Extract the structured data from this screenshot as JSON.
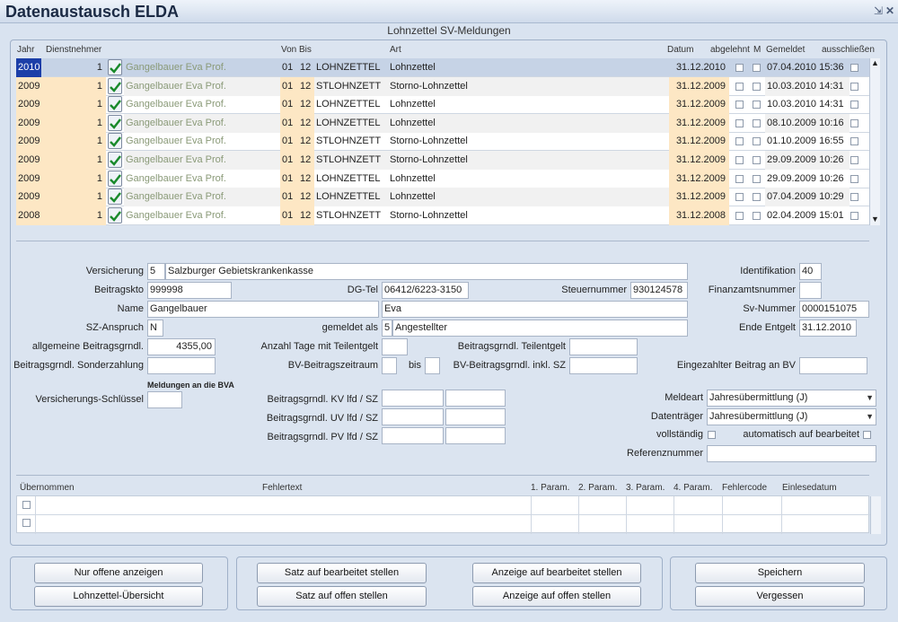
{
  "window": {
    "title": "Datenaustausch ELDA",
    "pin_icon": "pin-icon",
    "close_icon": "close-icon"
  },
  "subtitle": "Lohnzettel SV-Meldungen",
  "table": {
    "headers": {
      "jahr": "Jahr",
      "dn": "Dienstnehmer",
      "von": "Von",
      "bis": "Bis",
      "art": "Art",
      "datum": "Datum",
      "abgelehnt": "abgelehnt",
      "m": "M",
      "gemeldet": "Gemeldet",
      "ausschliessen": "ausschließen"
    },
    "rows": [
      {
        "jahr": "2010",
        "nr": "1",
        "name": "Gangelbauer Eva Prof.",
        "von": "01",
        "bis": "12",
        "code": "LOHNZETTEL",
        "art": "Lohnzettel",
        "datum": "31.12.2010",
        "gemeldet": "07.04.2010 15:36"
      },
      {
        "jahr": "2009",
        "nr": "1",
        "name": "Gangelbauer Eva Prof.",
        "von": "01",
        "bis": "12",
        "code": "STLOHNZETT",
        "art": "Storno-Lohnzettel",
        "datum": "31.12.2009",
        "gemeldet": "10.03.2010 14:31"
      },
      {
        "jahr": "2009",
        "nr": "1",
        "name": "Gangelbauer Eva Prof.",
        "von": "01",
        "bis": "12",
        "code": "LOHNZETTEL",
        "art": "Lohnzettel",
        "datum": "31.12.2009",
        "gemeldet": "10.03.2010 14:31"
      },
      {
        "jahr": "2009",
        "nr": "1",
        "name": "Gangelbauer Eva Prof.",
        "von": "01",
        "bis": "12",
        "code": "LOHNZETTEL",
        "art": "Lohnzettel",
        "datum": "31.12.2009",
        "gemeldet": "08.10.2009 10:16"
      },
      {
        "jahr": "2009",
        "nr": "1",
        "name": "Gangelbauer Eva Prof.",
        "von": "01",
        "bis": "12",
        "code": "STLOHNZETT",
        "art": "Storno-Lohnzettel",
        "datum": "31.12.2009",
        "gemeldet": "01.10.2009 16:55"
      },
      {
        "jahr": "2009",
        "nr": "1",
        "name": "Gangelbauer Eva Prof.",
        "von": "01",
        "bis": "12",
        "code": "STLOHNZETT",
        "art": "Storno-Lohnzettel",
        "datum": "31.12.2009",
        "gemeldet": "29.09.2009 10:26"
      },
      {
        "jahr": "2009",
        "nr": "1",
        "name": "Gangelbauer Eva Prof.",
        "von": "01",
        "bis": "12",
        "code": "LOHNZETTEL",
        "art": "Lohnzettel",
        "datum": "31.12.2009",
        "gemeldet": "29.09.2009 10:26"
      },
      {
        "jahr": "2009",
        "nr": "1",
        "name": "Gangelbauer Eva Prof.",
        "von": "01",
        "bis": "12",
        "code": "LOHNZETTEL",
        "art": "Lohnzettel",
        "datum": "31.12.2009",
        "gemeldet": "07.04.2009 10:29"
      },
      {
        "jahr": "2008",
        "nr": "1",
        "name": "Gangelbauer Eva Prof.",
        "von": "01",
        "bis": "12",
        "code": "STLOHNZETT",
        "art": "Storno-Lohnzettel",
        "datum": "31.12.2008",
        "gemeldet": "02.04.2009 15:01"
      }
    ]
  },
  "form": {
    "versicherung": {
      "label": "Versicherung",
      "nr": "5",
      "value": "Salzburger Gebietskrankenkasse"
    },
    "identifikation": {
      "label": "Identifikation",
      "value": "40"
    },
    "beitragskto": {
      "label": "Beitragskto",
      "value": "999998"
    },
    "dgtel": {
      "label": "DG-Tel",
      "value": "06412/6223-3150"
    },
    "steuernummer": {
      "label": "Steuernummer",
      "value": "930124578"
    },
    "finanzamt": {
      "label": "Finanzamtsnummer",
      "value": ""
    },
    "name": {
      "label": "Name",
      "value": "Gangelbauer",
      "vorname": "Eva"
    },
    "svnummer": {
      "label": "Sv-Nummer",
      "value": "0000151075"
    },
    "szanspruch": {
      "label": "SZ-Anspruch",
      "value": "N"
    },
    "gemeldet_als": {
      "label": "gemeldet als",
      "nr": "5",
      "value": "Angestellter"
    },
    "ende_entgelt": {
      "label": "Ende Entgelt",
      "value": "31.12.2010"
    },
    "allg_bgl": {
      "label": "allgemeine Beitragsgrndl.",
      "value": "4355,00"
    },
    "tage_teilentgelt": {
      "label": "Anzahl Tage mit Teilentgelt",
      "value": ""
    },
    "bgl_teilentgelt": {
      "label": "Beitragsgrndl. Teilentgelt",
      "value": ""
    },
    "bgl_sonderzahlung": {
      "label": "Beitragsgrndl. Sonderzahlung",
      "value": ""
    },
    "bv_zeitraum": {
      "label": "BV-Beitragszeitraum",
      "bis": "bis"
    },
    "bv_bgl_sz": {
      "label": "BV-Beitragsgrndl. inkl. SZ",
      "value": ""
    },
    "bv_eingezahlt": {
      "label": "Eingezahlter Beitrag an BV",
      "value": ""
    },
    "bva_heading": "Meldungen an die BVA",
    "vers_schluessel": {
      "label": "Versicherungs-Schlüssel",
      "value": ""
    },
    "kv": {
      "label": "Beitragsgrndl. KV lfd / SZ"
    },
    "uv": {
      "label": "Beitragsgrndl. UV lfd / SZ"
    },
    "pv": {
      "label": "Beitragsgrndl. PV lfd / SZ"
    },
    "meldeart": {
      "label": "Meldeart",
      "value": "Jahresübermittlung (J)"
    },
    "datentraeger": {
      "label": "Datenträger",
      "value": "Jahresübermittlung (J)"
    },
    "vollstaendig": {
      "label": "vollständig"
    },
    "auto_bearbeitet": {
      "label": "automatisch auf bearbeitet"
    },
    "referenznummer": {
      "label": "Referenznummer",
      "value": ""
    }
  },
  "errors": {
    "headers": {
      "uebernommen": "Übernommen",
      "fehlertext": "Fehlertext",
      "p1": "1. Param.",
      "p2": "2. Param.",
      "p3": "3. Param.",
      "p4": "4. Param.",
      "code": "Fehlercode",
      "datum": "Einlesedatum"
    }
  },
  "buttons": {
    "nur_offene": "Nur offene anzeigen",
    "lohnzettel_uebersicht": "Lohnzettel-Übersicht",
    "satz_bearbeitet": "Satz auf bearbeitet stellen",
    "satz_offen": "Satz auf offen stellen",
    "anzeige_bearbeitet": "Anzeige auf bearbeitet stellen",
    "anzeige_offen": "Anzeige auf offen stellen",
    "speichern": "Speichern",
    "vergessen": "Vergessen"
  },
  "colors": {
    "selected_row": "#c6d3e6",
    "peach": "#fde7c4",
    "name_text": "#8a9a78"
  }
}
